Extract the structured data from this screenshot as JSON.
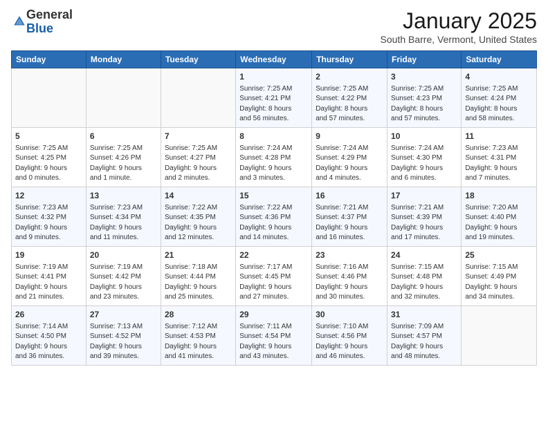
{
  "logo": {
    "general": "General",
    "blue": "Blue"
  },
  "header": {
    "month": "January 2025",
    "location": "South Barre, Vermont, United States"
  },
  "weekdays": [
    "Sunday",
    "Monday",
    "Tuesday",
    "Wednesday",
    "Thursday",
    "Friday",
    "Saturday"
  ],
  "weeks": [
    [
      {
        "day": "",
        "info": ""
      },
      {
        "day": "",
        "info": ""
      },
      {
        "day": "",
        "info": ""
      },
      {
        "day": "1",
        "info": "Sunrise: 7:25 AM\nSunset: 4:21 PM\nDaylight: 8 hours\nand 56 minutes."
      },
      {
        "day": "2",
        "info": "Sunrise: 7:25 AM\nSunset: 4:22 PM\nDaylight: 8 hours\nand 57 minutes."
      },
      {
        "day": "3",
        "info": "Sunrise: 7:25 AM\nSunset: 4:23 PM\nDaylight: 8 hours\nand 57 minutes."
      },
      {
        "day": "4",
        "info": "Sunrise: 7:25 AM\nSunset: 4:24 PM\nDaylight: 8 hours\nand 58 minutes."
      }
    ],
    [
      {
        "day": "5",
        "info": "Sunrise: 7:25 AM\nSunset: 4:25 PM\nDaylight: 9 hours\nand 0 minutes."
      },
      {
        "day": "6",
        "info": "Sunrise: 7:25 AM\nSunset: 4:26 PM\nDaylight: 9 hours\nand 1 minute."
      },
      {
        "day": "7",
        "info": "Sunrise: 7:25 AM\nSunset: 4:27 PM\nDaylight: 9 hours\nand 2 minutes."
      },
      {
        "day": "8",
        "info": "Sunrise: 7:24 AM\nSunset: 4:28 PM\nDaylight: 9 hours\nand 3 minutes."
      },
      {
        "day": "9",
        "info": "Sunrise: 7:24 AM\nSunset: 4:29 PM\nDaylight: 9 hours\nand 4 minutes."
      },
      {
        "day": "10",
        "info": "Sunrise: 7:24 AM\nSunset: 4:30 PM\nDaylight: 9 hours\nand 6 minutes."
      },
      {
        "day": "11",
        "info": "Sunrise: 7:23 AM\nSunset: 4:31 PM\nDaylight: 9 hours\nand 7 minutes."
      }
    ],
    [
      {
        "day": "12",
        "info": "Sunrise: 7:23 AM\nSunset: 4:32 PM\nDaylight: 9 hours\nand 9 minutes."
      },
      {
        "day": "13",
        "info": "Sunrise: 7:23 AM\nSunset: 4:34 PM\nDaylight: 9 hours\nand 11 minutes."
      },
      {
        "day": "14",
        "info": "Sunrise: 7:22 AM\nSunset: 4:35 PM\nDaylight: 9 hours\nand 12 minutes."
      },
      {
        "day": "15",
        "info": "Sunrise: 7:22 AM\nSunset: 4:36 PM\nDaylight: 9 hours\nand 14 minutes."
      },
      {
        "day": "16",
        "info": "Sunrise: 7:21 AM\nSunset: 4:37 PM\nDaylight: 9 hours\nand 16 minutes."
      },
      {
        "day": "17",
        "info": "Sunrise: 7:21 AM\nSunset: 4:39 PM\nDaylight: 9 hours\nand 17 minutes."
      },
      {
        "day": "18",
        "info": "Sunrise: 7:20 AM\nSunset: 4:40 PM\nDaylight: 9 hours\nand 19 minutes."
      }
    ],
    [
      {
        "day": "19",
        "info": "Sunrise: 7:19 AM\nSunset: 4:41 PM\nDaylight: 9 hours\nand 21 minutes."
      },
      {
        "day": "20",
        "info": "Sunrise: 7:19 AM\nSunset: 4:42 PM\nDaylight: 9 hours\nand 23 minutes."
      },
      {
        "day": "21",
        "info": "Sunrise: 7:18 AM\nSunset: 4:44 PM\nDaylight: 9 hours\nand 25 minutes."
      },
      {
        "day": "22",
        "info": "Sunrise: 7:17 AM\nSunset: 4:45 PM\nDaylight: 9 hours\nand 27 minutes."
      },
      {
        "day": "23",
        "info": "Sunrise: 7:16 AM\nSunset: 4:46 PM\nDaylight: 9 hours\nand 30 minutes."
      },
      {
        "day": "24",
        "info": "Sunrise: 7:15 AM\nSunset: 4:48 PM\nDaylight: 9 hours\nand 32 minutes."
      },
      {
        "day": "25",
        "info": "Sunrise: 7:15 AM\nSunset: 4:49 PM\nDaylight: 9 hours\nand 34 minutes."
      }
    ],
    [
      {
        "day": "26",
        "info": "Sunrise: 7:14 AM\nSunset: 4:50 PM\nDaylight: 9 hours\nand 36 minutes."
      },
      {
        "day": "27",
        "info": "Sunrise: 7:13 AM\nSunset: 4:52 PM\nDaylight: 9 hours\nand 39 minutes."
      },
      {
        "day": "28",
        "info": "Sunrise: 7:12 AM\nSunset: 4:53 PM\nDaylight: 9 hours\nand 41 minutes."
      },
      {
        "day": "29",
        "info": "Sunrise: 7:11 AM\nSunset: 4:54 PM\nDaylight: 9 hours\nand 43 minutes."
      },
      {
        "day": "30",
        "info": "Sunrise: 7:10 AM\nSunset: 4:56 PM\nDaylight: 9 hours\nand 46 minutes."
      },
      {
        "day": "31",
        "info": "Sunrise: 7:09 AM\nSunset: 4:57 PM\nDaylight: 9 hours\nand 48 minutes."
      },
      {
        "day": "",
        "info": ""
      }
    ]
  ]
}
